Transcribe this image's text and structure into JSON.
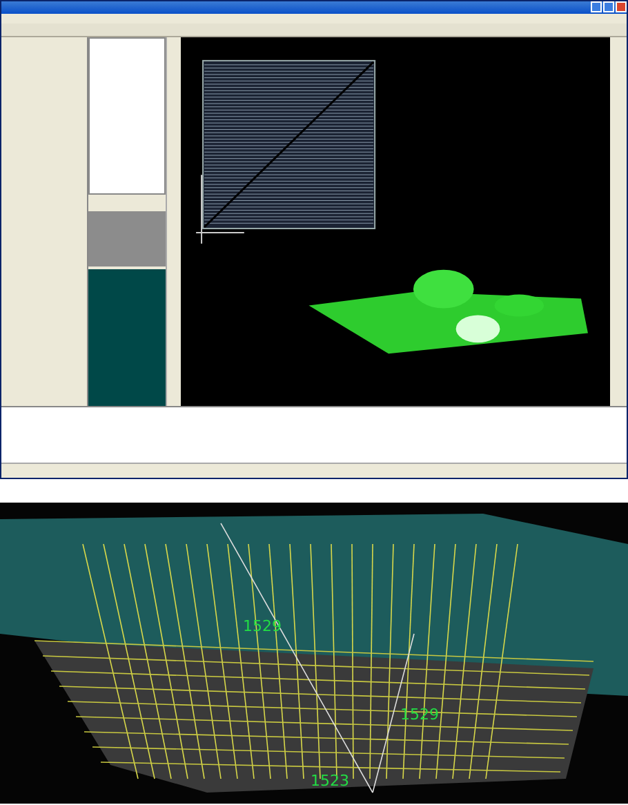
{
  "render_view": {
    "labels": [
      {
        "text": "1529"
      },
      {
        "text": "1529"
      },
      {
        "text": "1523"
      }
    ]
  }
}
